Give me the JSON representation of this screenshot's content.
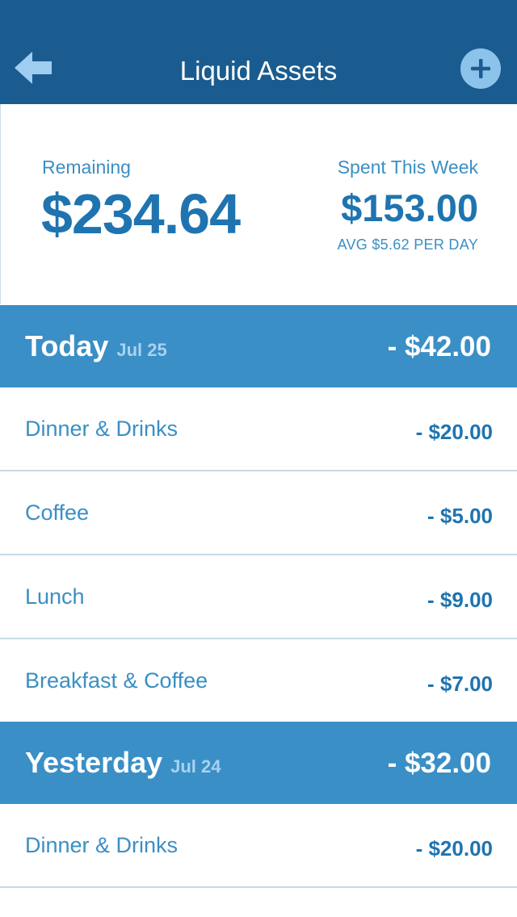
{
  "nav": {
    "title": "Liquid Assets",
    "back_icon": "back-arrow-icon",
    "add_icon": "plus-icon"
  },
  "summary": {
    "remaining_label": "Remaining",
    "remaining_amount": "$234.64",
    "spent_label": "Spent This Week",
    "spent_amount": "$153.00",
    "avg_text": "AVG $5.62 PER DAY"
  },
  "days": [
    {
      "name": "Today",
      "date": "Jul 25",
      "total": "- $42.00",
      "items": [
        {
          "name": "Dinner & Drinks",
          "amount": "- $20.00"
        },
        {
          "name": "Coffee",
          "amount": "- $5.00"
        },
        {
          "name": "Lunch",
          "amount": "- $9.00"
        },
        {
          "name": "Breakfast & Coffee",
          "amount": "- $7.00"
        }
      ]
    },
    {
      "name": "Yesterday",
      "date": "Jul 24",
      "total": "- $32.00",
      "items": [
        {
          "name": "Dinner & Drinks",
          "amount": "- $20.00"
        }
      ]
    }
  ],
  "colors": {
    "nav_bg": "#1a5c8f",
    "header_bg": "#3a8fc6",
    "accent": "#1f74b0",
    "light_text": "#3a8fc4",
    "add_button": "#8cc3ea"
  }
}
